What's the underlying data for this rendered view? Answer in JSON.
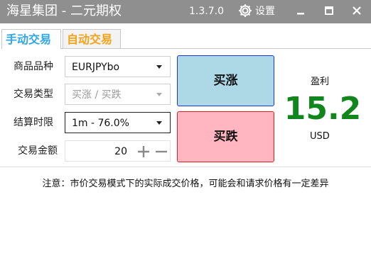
{
  "window": {
    "title": "海星集团 - 二元期权",
    "version": "1.3.7.0",
    "settings_label": "设置"
  },
  "tabs": [
    {
      "label": "手动交易",
      "active": true
    },
    {
      "label": "自动交易",
      "active": false
    }
  ],
  "form": {
    "product": {
      "label": "商品品种",
      "value": "EURJPYbo"
    },
    "trade_type": {
      "label": "交易类型",
      "value": "买涨 / 买跌"
    },
    "settlement": {
      "label": "结算时限",
      "value": "1m - 76.0%"
    },
    "amount": {
      "label": "交易金额",
      "value": "20"
    }
  },
  "actions": {
    "buy_up": "买涨",
    "buy_down": "买跌"
  },
  "profit": {
    "label": "盈利",
    "value": "15.2",
    "unit": "USD"
  },
  "notice": "注意：市价交易模式下的实际成交价格，可能会和请求价格有一定差异",
  "colors": {
    "titlebar": "#8f8f8f",
    "tab_active": "#2fa6ea",
    "tab_inactive": "#f5a219",
    "buy_up_bg": "#add8e6",
    "buy_down_bg": "#ffb6c1",
    "profit": "#11861c"
  },
  "icons": [
    "gear-icon",
    "minimize-icon",
    "maximize-icon",
    "close-icon",
    "chevron-down-icon",
    "plus-icon",
    "minus-icon"
  ]
}
